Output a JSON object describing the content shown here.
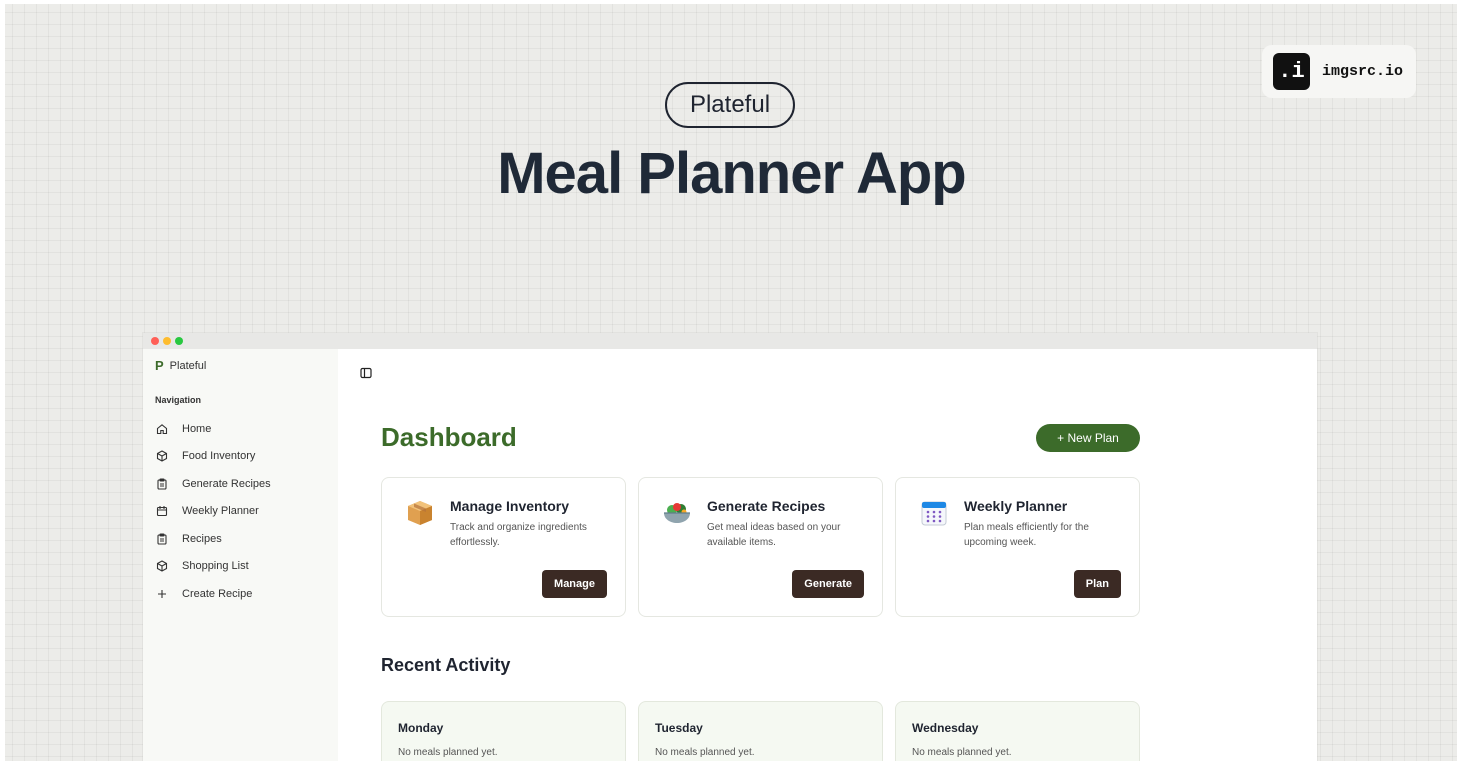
{
  "hero": {
    "brand_pill": "Plateful",
    "title": "Meal Planner App"
  },
  "watermark": {
    "logo": ".i",
    "text": "imgsrc.io"
  },
  "window": {
    "traffic_lights": [
      "#ff5f57",
      "#febc2e",
      "#28c840"
    ]
  },
  "sidebar": {
    "brand_letter": "P",
    "brand_name": "Plateful",
    "section_label": "Navigation",
    "items": [
      {
        "label": "Home",
        "icon": "home-icon"
      },
      {
        "label": "Food Inventory",
        "icon": "box-icon"
      },
      {
        "label": "Generate Recipes",
        "icon": "clipboard-icon"
      },
      {
        "label": "Weekly Planner",
        "icon": "calendar-icon"
      },
      {
        "label": "Recipes",
        "icon": "clipboard-icon"
      },
      {
        "label": "Shopping List",
        "icon": "box-icon"
      },
      {
        "label": "Create Recipe",
        "icon": "plus-icon"
      }
    ]
  },
  "main": {
    "title": "Dashboard",
    "new_plan_label": "+ New Plan",
    "cards": [
      {
        "title": "Manage Inventory",
        "description": "Track and organize ingredients effortlessly.",
        "button": "Manage",
        "icon": "package-icon"
      },
      {
        "title": "Generate Recipes",
        "description": "Get meal ideas based on your available items.",
        "button": "Generate",
        "icon": "salad-icon"
      },
      {
        "title": "Weekly Planner",
        "description": "Plan meals efficiently for the upcoming week.",
        "button": "Plan",
        "icon": "calendar-icon"
      }
    ],
    "recent_title": "Recent Activity",
    "days": [
      {
        "name": "Monday",
        "status": "No meals planned yet."
      },
      {
        "name": "Tuesday",
        "status": "No meals planned yet."
      },
      {
        "name": "Wednesday",
        "status": "No meals planned yet."
      }
    ]
  },
  "colors": {
    "accent_green": "#3c6b2a",
    "button_brown": "#3b2a24"
  }
}
